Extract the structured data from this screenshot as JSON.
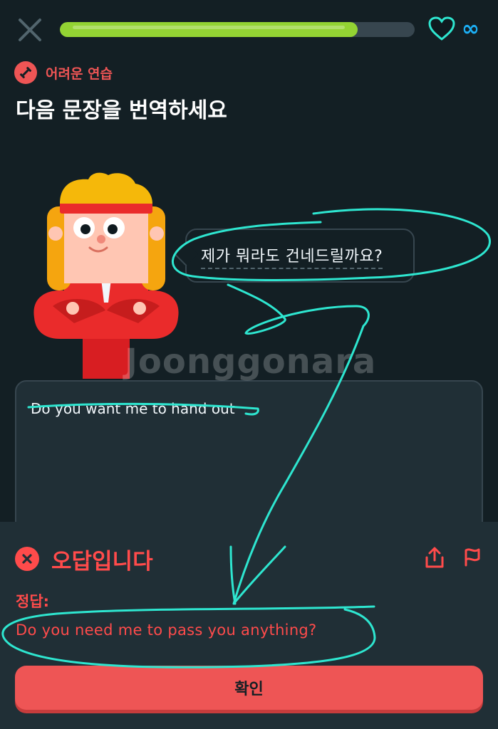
{
  "header": {
    "progress_fraction": 0.84,
    "hearts_value": "∞",
    "colors": {
      "progress": "#93d333",
      "track": "#37464f",
      "heart": "#1cb0f6"
    }
  },
  "badge": {
    "label": "어려운 연습",
    "icon": "dumbbell-icon",
    "color": "#ee5555"
  },
  "instruction": "다음 문장을 번역하세요",
  "prompt": {
    "sentence": "제가 뭐라도 건네드릴까요?"
  },
  "answer": {
    "text": "Do you want me to hand out"
  },
  "watermark": "Joonggonara",
  "feedback": {
    "title": "오답입니다",
    "correct_label": "정답:",
    "correct_answer": "Do you need me to pass you anything?",
    "confirm_label": "확인",
    "colors": {
      "accent": "#ff4b4b",
      "button": "#ee5555"
    }
  },
  "annotation_color": "#2ee6d0"
}
